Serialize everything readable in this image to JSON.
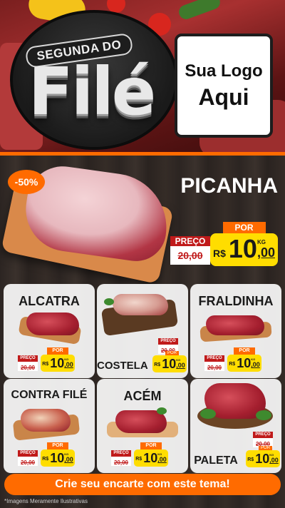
{
  "header": {
    "badge_top": "SEGUNDA DO",
    "badge_main": "Filé",
    "logo_line1": "Sua Logo",
    "logo_line2": "Aqui"
  },
  "featured": {
    "name": "PICANHA",
    "discount": "-50%",
    "old_label": "PREÇO",
    "old_price": "20,00",
    "new_label": "POR",
    "currency": "R$",
    "price_int": "10",
    "price_cents": ",00",
    "unit": "KG"
  },
  "products": [
    {
      "name": "ALCATRA",
      "old_label": "PREÇO",
      "old_price": "20,00",
      "new_label": "POR",
      "currency": "R$",
      "price_int": "10",
      "price_cents": ",00",
      "unit": "KG"
    },
    {
      "name": "COSTELA",
      "old_label": "PREÇO",
      "old_price": "20,00",
      "new_label": "POR",
      "currency": "R$",
      "price_int": "10",
      "price_cents": ",00",
      "unit": "KG"
    },
    {
      "name": "FRALDINHA",
      "old_label": "PREÇO",
      "old_price": "20,00",
      "new_label": "POR",
      "currency": "R$",
      "price_int": "10",
      "price_cents": ",00",
      "unit": "KG"
    },
    {
      "name": "CONTRA FILÉ",
      "old_label": "PREÇO",
      "old_price": "20,00",
      "new_label": "POR",
      "currency": "R$",
      "price_int": "10",
      "price_cents": ",00",
      "unit": "KG"
    },
    {
      "name": "ACÉM",
      "old_label": "PREÇO",
      "old_price": "20,00",
      "new_label": "POR",
      "currency": "R$",
      "price_int": "10",
      "price_cents": ",00",
      "unit": "KG"
    },
    {
      "name": "PALETA",
      "old_label": "PREÇO",
      "old_price": "20,00",
      "new_label": "POR",
      "currency": "R$",
      "price_int": "10",
      "price_cents": ",00",
      "unit": "KG"
    }
  ],
  "cta": "Crie seu encarte com este tema!",
  "disclaimer": "*Imagens Meramente Ilustrativas",
  "colors": {
    "accent_orange": "#ff6b00",
    "price_yellow": "#ffdd00",
    "label_red": "#c01a1a"
  }
}
